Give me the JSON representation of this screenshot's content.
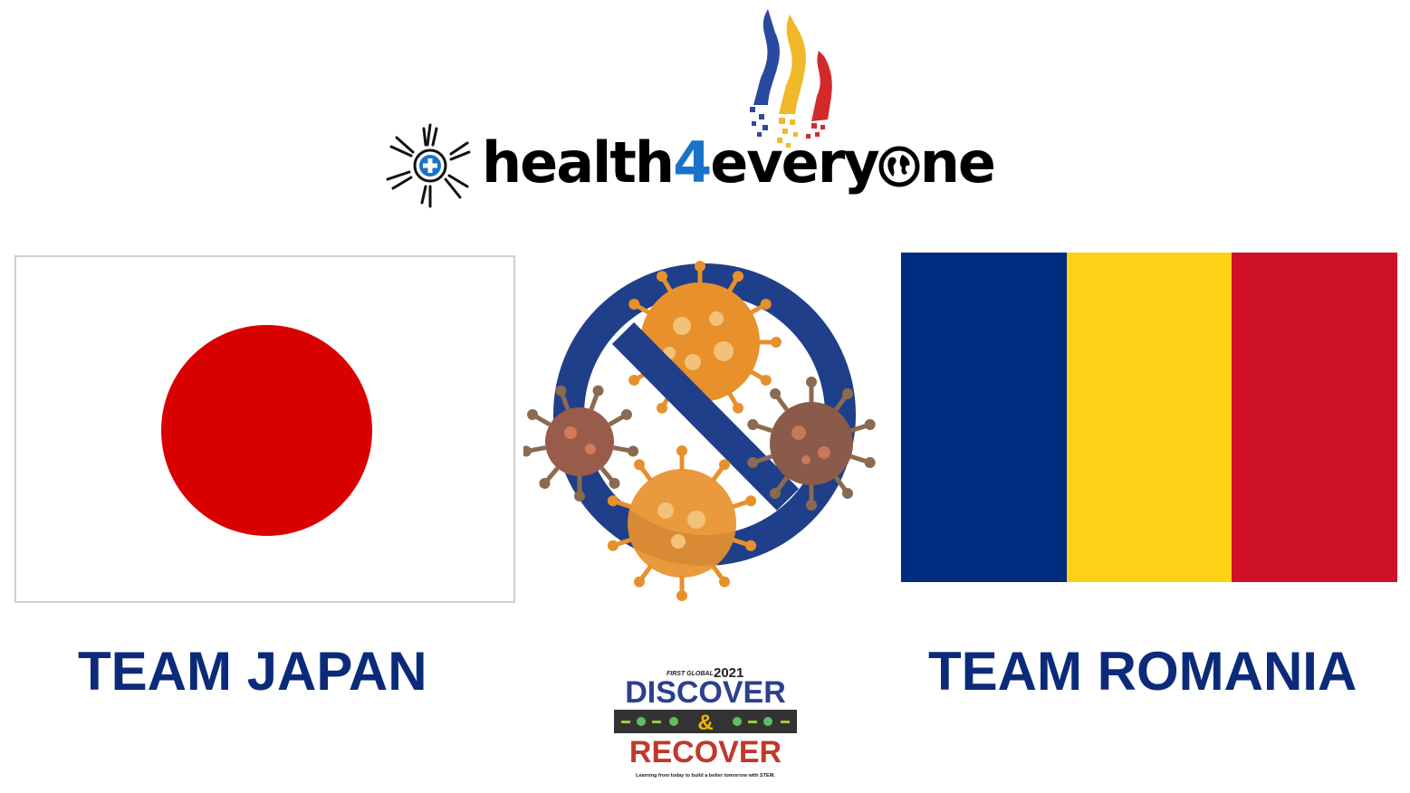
{
  "logo": {
    "wordmark_part1": "health",
    "wordmark_digit": "4",
    "wordmark_part2": "every",
    "wordmark_part3": "ne",
    "accent_color": "#1a73c9",
    "icons": [
      "hands-circle-icon",
      "globe-icon",
      "pixel-flame-icon"
    ]
  },
  "flags": {
    "japan": {
      "background": "#ffffff",
      "disc": "#d90000",
      "border": "#cfcfcf"
    },
    "romania": {
      "bands": [
        "#002b7f",
        "#fcd116",
        "#ce1126"
      ]
    }
  },
  "labels": {
    "japan": "TEAM JAPAN",
    "romania": "TEAM ROMANIA",
    "color": "#0b2b7a"
  },
  "virus_graphic": {
    "icon": "no-virus-icon",
    "ring_color": "#1f3f8a",
    "virus_colors": [
      "#e8902c",
      "#8a5a4a"
    ]
  },
  "event_logo": {
    "org": "FIRST GLOBAL",
    "year": "2021",
    "line1": "DISCOVER",
    "amp": "&",
    "line2": "RECOVER",
    "tagline": "Learning from today to build a better tomorrow with STEM.",
    "colors": {
      "discover": "#2c3f8f",
      "recover": "#c0392b",
      "road": "#333333",
      "amp": "#f2b705"
    }
  }
}
